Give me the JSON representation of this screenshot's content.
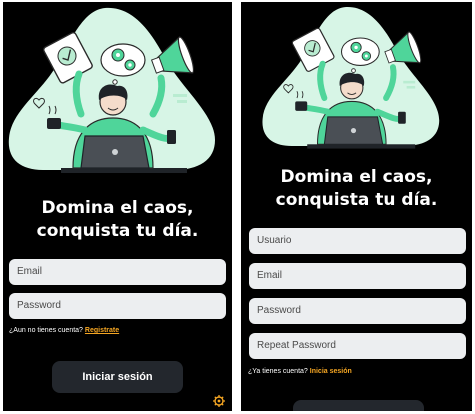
{
  "login": {
    "headline_line1": "Domina el caos,",
    "headline_line2": "conquista tu día.",
    "email_placeholder": "Email",
    "password_placeholder": "Password",
    "prompt": "¿Aun no tienes cuenta?",
    "register_link": "Registrate",
    "submit_label": "Iniciar sesión",
    "settings_icon": "gear-icon"
  },
  "register": {
    "headline_line1": "Domina el caos,",
    "headline_line2": "conquista tu día.",
    "username_placeholder": "Usuario",
    "email_placeholder": "Email",
    "password_placeholder": "Password",
    "repeat_password_placeholder": "Repeat Password",
    "prompt": "¿Ya tienes cuenta?",
    "login_link": "Inicia sesión",
    "submit_label": ""
  },
  "colors": {
    "background": "#000000",
    "field_bg": "#eceef0",
    "link": "#f5a623",
    "button_bg": "#23272d",
    "illustration_mint": "#d7f5e6",
    "accent_green": "#4fd59a"
  }
}
